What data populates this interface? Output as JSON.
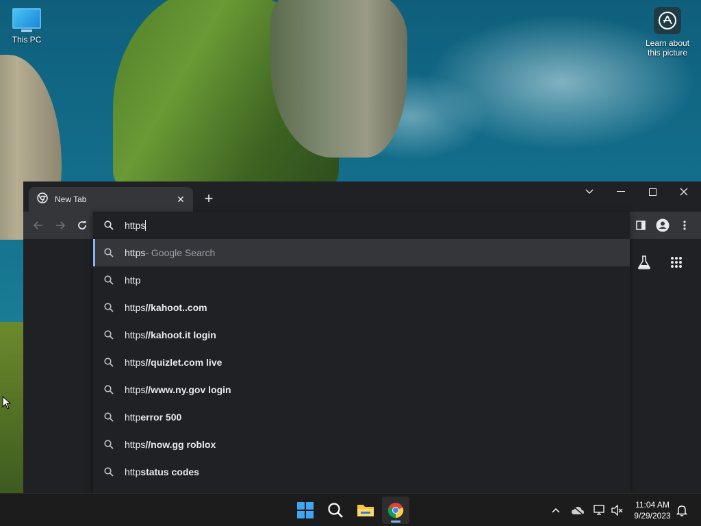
{
  "desktop": {
    "icons": [
      {
        "label": "This PC"
      },
      {
        "label": "Learn about this picture"
      }
    ]
  },
  "browser": {
    "tab": {
      "title": "New Tab"
    },
    "omnibox": {
      "value": "https",
      "suggestions": [
        {
          "typed": "https",
          "rest": "",
          "desc": " - Google Search",
          "selected": true
        },
        {
          "typed": "http",
          "rest": "",
          "desc": ""
        },
        {
          "typed": "https",
          "rest": " //kahoot..com",
          "desc": ""
        },
        {
          "typed": "https",
          "rest": " //kahoot.it login",
          "desc": ""
        },
        {
          "typed": "https",
          "rest": " //quizlet.com live",
          "desc": ""
        },
        {
          "typed": "https",
          "rest": " //www.ny.gov login",
          "desc": ""
        },
        {
          "typed": "http",
          "rest": " error 500",
          "desc": ""
        },
        {
          "typed": "https",
          "rest": " //now.gg roblox",
          "desc": ""
        },
        {
          "typed": "http",
          "rest": " status codes",
          "desc": ""
        }
      ]
    }
  },
  "taskbar": {
    "time": "11:04 AM",
    "date": "9/29/2023"
  },
  "colors": {
    "window_bg": "#202124",
    "toolbar_bg": "#35363a",
    "accent": "#8ab4f8",
    "taskbar_bg": "#1c1c1c"
  }
}
